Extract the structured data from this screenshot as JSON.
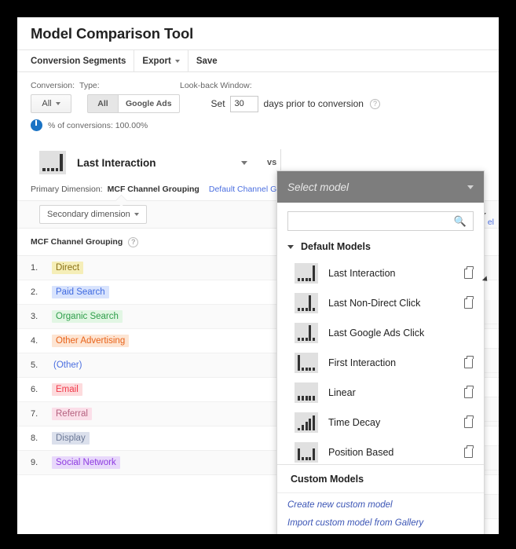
{
  "page": {
    "title": "Model Comparison Tool"
  },
  "toolbar": {
    "conversion_segments": "Conversion Segments",
    "export": "Export",
    "save": "Save"
  },
  "controls": {
    "conversion_label": "Conversion:",
    "conversion_value": "All",
    "type_label": "Type:",
    "type_all": "All",
    "type_google_ads": "Google Ads",
    "lookback_label": "Look-back Window:",
    "set_word": "Set",
    "days_value": "30",
    "days_suffix": "days prior to conversion",
    "help_glyph": "?",
    "conversions_pct": "% of conversions: 100.00%"
  },
  "model_row": {
    "name": "Last Interaction",
    "vs": "vs",
    "icon_bars": [
      4,
      4,
      4,
      4,
      22
    ]
  },
  "primary_dimension": {
    "label": "Primary Dimension:",
    "active": "MCF Channel Grouping",
    "link": "Default Channel Grouping",
    "link_cut": "el"
  },
  "secondary_dimension": {
    "button_label": "Secondary dimension"
  },
  "table": {
    "column_header": "MCF Channel Grouping",
    "rows": [
      {
        "num": "1.",
        "label": "Direct",
        "color": "#8a7015",
        "bg": "#f5eeb8"
      },
      {
        "num": "2.",
        "label": "Paid Search",
        "color": "#3f6ae0",
        "bg": "#d8e3fd"
      },
      {
        "num": "3.",
        "label": "Organic Search",
        "color": "#2e9e4a",
        "bg": "#e2f6e4"
      },
      {
        "num": "4.",
        "label": "Other Advertising",
        "color": "#e8631a",
        "bg": "#fde5d3"
      },
      {
        "num": "5.",
        "label": "(Other)",
        "color": "#4a6ee0",
        "bg": "transparent"
      },
      {
        "num": "6.",
        "label": "Email",
        "color": "#f0394a",
        "bg": "#fddbdd"
      },
      {
        "num": "7.",
        "label": "Referral",
        "color": "#b5617f",
        "bg": "#fbdfe9"
      },
      {
        "num": "8.",
        "label": "Display",
        "color": "#6b7896",
        "bg": "#dbe0ec"
      },
      {
        "num": "9.",
        "label": "Social Network",
        "color": "#8e3ce0",
        "bg": "#e8d8fb"
      }
    ]
  },
  "dropdown": {
    "placeholder": "Select model",
    "search_value": "",
    "search_icon": "search-icon",
    "default_models_header": "Default Models",
    "items": [
      {
        "label": "Last Interaction",
        "bars": [
          4,
          4,
          4,
          4,
          20
        ],
        "copy": true
      },
      {
        "label": "Last Non-Direct Click",
        "bars": [
          4,
          4,
          4,
          20,
          4
        ],
        "copy": true
      },
      {
        "label": "Last Google Ads Click",
        "bars": [
          4,
          4,
          4,
          20,
          4
        ],
        "copy": false
      },
      {
        "label": "First Interaction",
        "bars": [
          20,
          4,
          4,
          4,
          4
        ],
        "copy": true
      },
      {
        "label": "Linear",
        "bars": [
          6,
          6,
          6,
          6,
          6
        ],
        "copy": true
      },
      {
        "label": "Time Decay",
        "bars": [
          3,
          7,
          11,
          15,
          19
        ],
        "copy": true
      },
      {
        "label": "Position Based",
        "bars": [
          15,
          4,
          4,
          4,
          15
        ],
        "copy": true
      }
    ],
    "custom_models_header": "Custom Models",
    "create_link": "Create new custom model",
    "import_link": "Import custom model from Gallery"
  }
}
